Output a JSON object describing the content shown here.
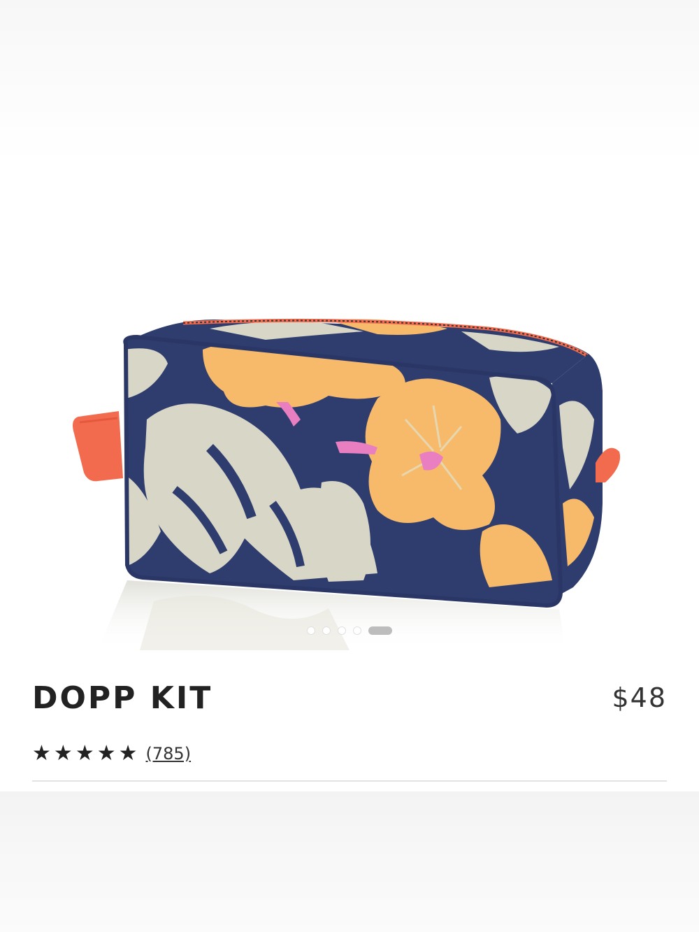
{
  "product": {
    "name": "DOPP KIT",
    "price": "$48",
    "rating": 5,
    "stars": [
      "★",
      "★",
      "★",
      "★",
      "★"
    ],
    "review_count": "(785)",
    "image_icon": "dopp-kit-product-image"
  },
  "carousel": {
    "total": 5,
    "active_index": 4
  },
  "colors": {
    "navy": "#2f3d6e",
    "cream": "#d8d6c6",
    "peach": "#f7b96a",
    "coral": "#f36b4f",
    "pink": "#e97fc0"
  }
}
